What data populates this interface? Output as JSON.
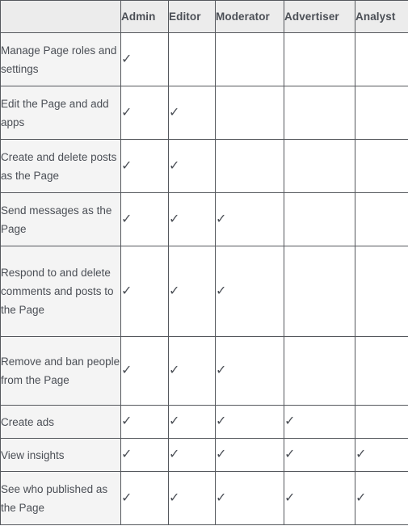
{
  "table": {
    "name": "page-roles-permissions-table",
    "columns": [
      {
        "key": "task",
        "label": ""
      },
      {
        "key": "admin",
        "label": "Admin"
      },
      {
        "key": "editor",
        "label": "Editor"
      },
      {
        "key": "moderator",
        "label": "Moderator"
      },
      {
        "key": "advertiser",
        "label": "Advertiser"
      },
      {
        "key": "analyst",
        "label": "Analyst"
      }
    ],
    "check_glyph": "✓",
    "colors": {
      "border": "#55585d",
      "header_bg": "#ececec",
      "task_bg": "#f4f4f4",
      "cell_bg": "#ffffff",
      "text": "#4b4f56"
    },
    "rows": [
      {
        "task": "Manage Page roles and settings",
        "lines": 2,
        "admin": true,
        "editor": false,
        "moderator": false,
        "advertiser": false,
        "analyst": false
      },
      {
        "task": "Edit the Page and add apps",
        "lines": 2,
        "admin": true,
        "editor": true,
        "moderator": false,
        "advertiser": false,
        "analyst": false
      },
      {
        "task": "Create and delete posts as the Page",
        "lines": 2,
        "admin": true,
        "editor": true,
        "moderator": false,
        "advertiser": false,
        "analyst": false
      },
      {
        "task": "Send messages as the Page",
        "lines": 2,
        "admin": true,
        "editor": true,
        "moderator": true,
        "advertiser": false,
        "analyst": false
      },
      {
        "task": "Respond to and delete comments and posts to the Page",
        "lines": 4,
        "admin": true,
        "editor": true,
        "moderator": true,
        "advertiser": false,
        "analyst": false
      },
      {
        "task": "Remove and ban people from the Page",
        "lines": 3,
        "admin": true,
        "editor": true,
        "moderator": true,
        "advertiser": false,
        "analyst": false
      },
      {
        "task": "Create ads",
        "lines": 1,
        "admin": true,
        "editor": true,
        "moderator": true,
        "advertiser": true,
        "analyst": false
      },
      {
        "task": "View insights",
        "lines": 1,
        "admin": true,
        "editor": true,
        "moderator": true,
        "advertiser": true,
        "analyst": true
      },
      {
        "task": "See who published as the Page",
        "lines": 2,
        "admin": true,
        "editor": true,
        "moderator": true,
        "advertiser": true,
        "analyst": true
      }
    ]
  }
}
